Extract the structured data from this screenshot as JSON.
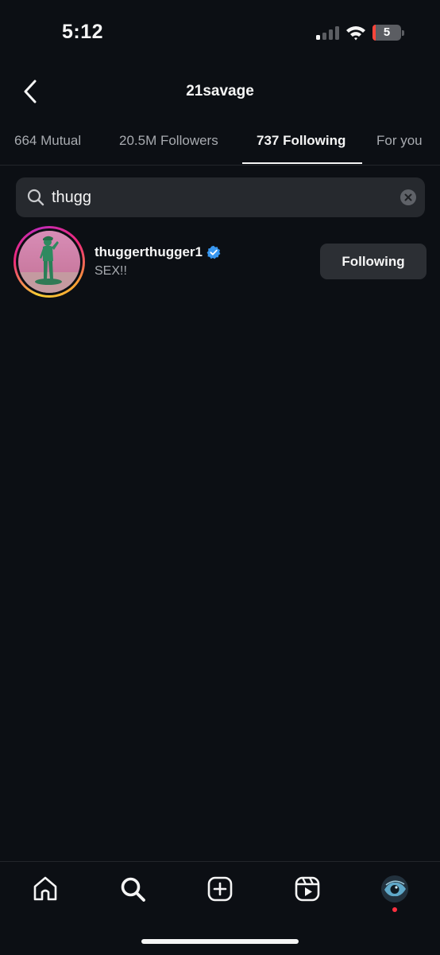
{
  "status_bar": {
    "time": "5:12",
    "battery_level": "5",
    "battery_color": "#ff453a",
    "icons": [
      "signal-icon",
      "wifi-icon",
      "battery-icon"
    ]
  },
  "header": {
    "title": "21savage",
    "back_icon": "chevron-left-icon"
  },
  "tabs": [
    {
      "label": "664 Mutual",
      "active": false
    },
    {
      "label": "20.5M Followers",
      "active": false
    },
    {
      "label": "737 Following",
      "active": true
    },
    {
      "label": "For you",
      "active": false
    }
  ],
  "search": {
    "value": "thugg",
    "icon": "search-icon",
    "clear_icon": "clear-icon"
  },
  "results": [
    {
      "username": "thuggerthugger1",
      "verified": true,
      "bio": "SEX!!",
      "button_label": "Following",
      "story_ring": true
    }
  ],
  "bottom_nav": {
    "items": [
      "home-icon",
      "search-icon",
      "create-icon",
      "reels-icon",
      "profile-avatar"
    ],
    "active": "search",
    "notification_dot": true,
    "notification_color": "#ff3040"
  },
  "colors": {
    "background": "#0c0f14",
    "verified_blue": "#3897f0",
    "button_bg": "#2c2f34"
  }
}
